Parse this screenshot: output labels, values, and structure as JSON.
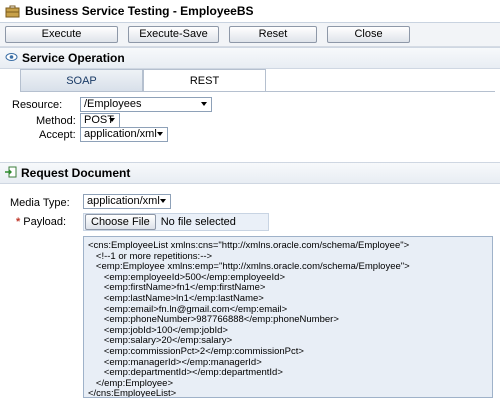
{
  "window": {
    "title": "Business Service Testing - EmployeeBS",
    "icon": "business-service-icon"
  },
  "toolbar": {
    "execute": "Execute",
    "execute_save": "Execute-Save",
    "reset": "Reset",
    "close": "Close"
  },
  "service_operation": {
    "title": "Service Operation",
    "icon": "eye-icon",
    "tabs": [
      {
        "label": "SOAP"
      },
      {
        "label": "REST"
      }
    ],
    "active_tab": "REST"
  },
  "form": {
    "resource_label": "Resource:",
    "resource_value": "/Employees",
    "method_label": "Method:",
    "method_value": "POST",
    "accept_label": "Accept:",
    "accept_value": "application/xml"
  },
  "request_document": {
    "title": "Request Document",
    "icon": "document-arrow-icon",
    "media_type_label": "Media Type:",
    "media_type_value": "application/xml",
    "payload_required": "*",
    "payload_label": "Payload:",
    "choose_file": "Choose File",
    "file_status": "No file selected",
    "xml_lines": [
      "<cns:EmployeeList xmlns:cns=\"http://xmlns.oracle.com/schema/Employee\">",
      "   <!--1 or more repetitions:-->",
      "   <emp:Employee xmlns:emp=\"http://xmlns.oracle.com/schema/Employee\">",
      "      <emp:employeeId>500</emp:employeeId>",
      "      <emp:firstName>fn1</emp:firstName>",
      "      <emp:lastName>ln1</emp:lastName>",
      "      <emp:email>fn.ln@gmail.com</emp:email>",
      "      <emp:phoneNumber>987766888</emp:phoneNumber>",
      "      <emp:jobId>100</emp:jobId>",
      "      <emp:salary>20</emp:salary>",
      "      <emp:commissionPct>2</emp:commissionPct>",
      "      <emp:managerId></emp:managerId>",
      "      <emp:departmentId></emp:departmentId>",
      "   </emp:Employee>",
      "</cns:EmployeeList>"
    ]
  }
}
